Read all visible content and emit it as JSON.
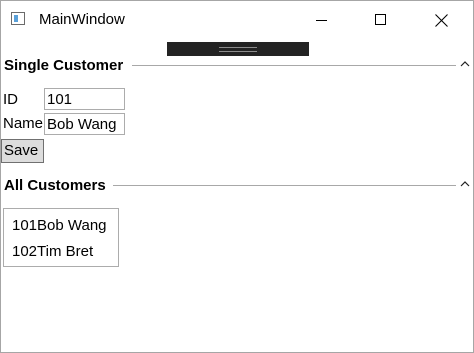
{
  "window": {
    "title": "MainWindow",
    "icon": "wpf-window-icon",
    "controls": [
      "minimize-icon",
      "maximize-icon",
      "close-icon"
    ]
  },
  "single_customer": {
    "header": "Single Customer",
    "expanded": true,
    "id_label": "ID",
    "id_value": "101",
    "name_label": "Name",
    "name_value": "Bob Wang",
    "save_label": "Save"
  },
  "all_customers": {
    "header": "All Customers",
    "expanded": true,
    "items": [
      {
        "id": "101",
        "name": "Bob Wang"
      },
      {
        "id": "102",
        "name": "Tim Bret"
      }
    ]
  }
}
